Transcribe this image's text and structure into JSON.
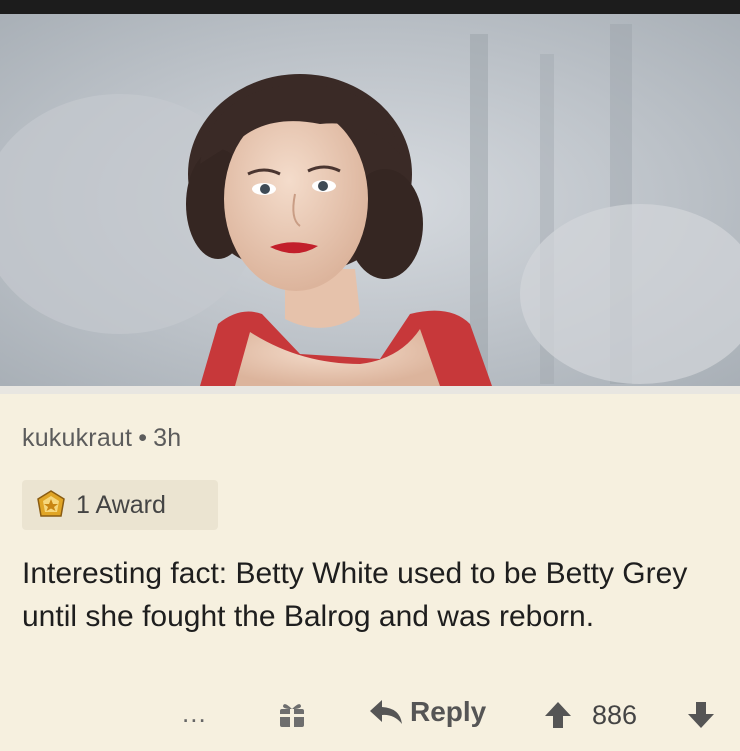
{
  "post": {
    "image_alt": "Portrait photo of a woman with dark curled hair wearing a red dress"
  },
  "comment": {
    "username": "kukukraut",
    "separator": "•",
    "time_ago": "3h",
    "award_label": "1 Award",
    "body": "Interesting fact: Betty White used to be Betty Grey until she fought the Balrog and was reborn.",
    "actions": {
      "more": "...",
      "reply_label": "Reply",
      "score": "886"
    }
  },
  "icons": [
    "more-icon",
    "gift-icon",
    "reply-arrow-icon",
    "upvote-icon",
    "downvote-icon",
    "award-badge-icon"
  ],
  "colors": {
    "comment_bg": "#f6f0df",
    "dress": "#c7383a",
    "award_gold": "#e0a526"
  }
}
